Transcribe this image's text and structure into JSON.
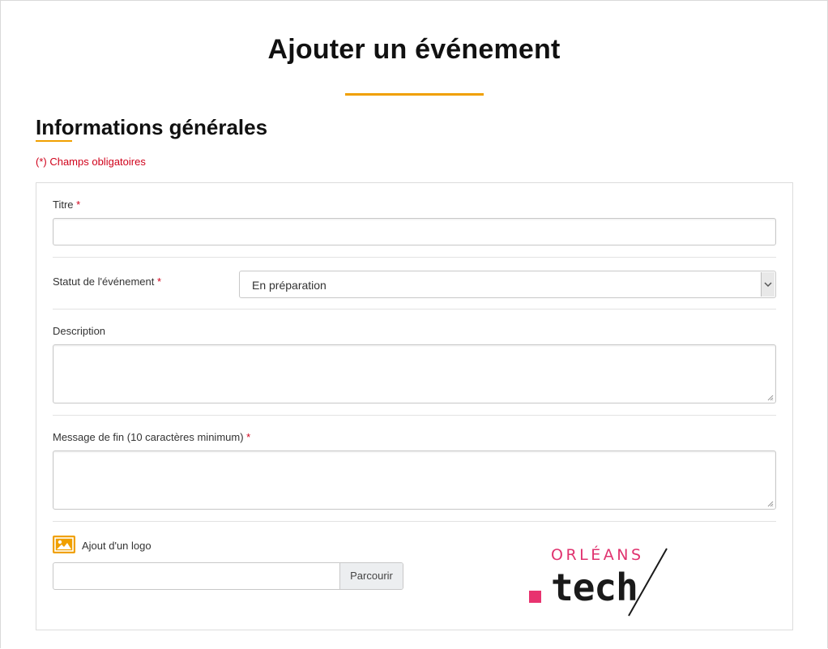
{
  "page": {
    "title": "Ajouter un événement"
  },
  "section": {
    "title": "Informations générales",
    "required_note": "(*) Champs obligatoires"
  },
  "form": {
    "titre": {
      "label": "Titre",
      "required_mark": "*",
      "value": ""
    },
    "statut": {
      "label": "Statut de l'événement",
      "required_mark": "*",
      "selected": "En préparation"
    },
    "description": {
      "label": "Description",
      "value": ""
    },
    "message_fin": {
      "label": "Message de fin (10 caractères minimum)",
      "required_mark": "*",
      "value": ""
    },
    "logo": {
      "label": "Ajout d'un logo",
      "browse_label": "Parcourir",
      "value": ""
    }
  },
  "brand": {
    "line1": "ORLÉANS",
    "line2": "tech"
  },
  "icons": {
    "image_icon": "image-icon",
    "select_arrow": "chevron-down-icon",
    "resize_grip": "resize-grip-icon"
  },
  "colors": {
    "accent": "#f0a000",
    "required": "#d0021b",
    "brand_pink": "#e0336f"
  }
}
